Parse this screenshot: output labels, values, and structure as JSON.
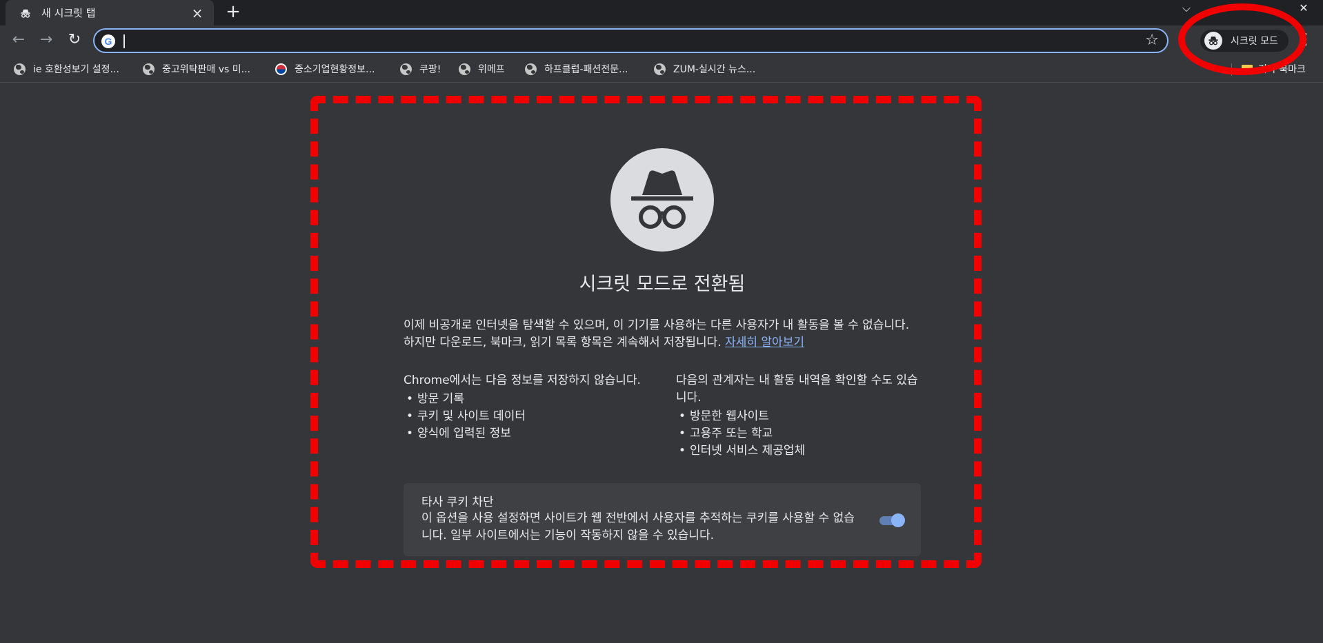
{
  "browser": {
    "tab_title": "새 시크릿 탭",
    "close_glyph": "×",
    "newtab_glyph": "+",
    "window_controls": {
      "chevron": "⌵",
      "minimize": "—",
      "close": "✕"
    },
    "nav": {
      "back": "←",
      "forward": "→",
      "reload": "↻"
    },
    "omnibox": {
      "logo_letter": "G",
      "value": "",
      "placeholder": "",
      "star": "☆"
    },
    "profile_chip": {
      "label": "시크릿 모드",
      "icon": "incognito-icon"
    },
    "menu_glyph": "⋮"
  },
  "bookmarks": {
    "items": [
      {
        "label": "ie 호환성보기 설정...",
        "icon": "globe-icon"
      },
      {
        "label": "중고위탁판매 vs 미...",
        "icon": "globe-icon"
      },
      {
        "label": "중소기업현황정보...",
        "icon": "korea-flag-icon"
      },
      {
        "label": "쿠팡!",
        "icon": "globe-icon"
      },
      {
        "label": "위메프",
        "icon": "globe-icon"
      },
      {
        "label": "하프클럽-패션전문...",
        "icon": "globe-icon"
      },
      {
        "label": "ZUM-실시간 뉴스...",
        "icon": "globe-icon"
      }
    ],
    "other": "기타 북마크"
  },
  "incognito_page": {
    "headline": "시크릿 모드로 전환됨",
    "intro_1": "이제 비공개로 인터넷을 탐색할 수 있으며, 이 기기를 사용하는 다른 사용자가 내 활동을 볼 수 없습니다. 하지만 다운로드, 북마크, 읽기 목록 항목은 계속해서 저장됩니다. ",
    "learn_more": "자세히 알아보기",
    "not_saved": {
      "heading": "Chrome에서는 다음 정보를 저장하지 않습니다.",
      "items": [
        "방문 기록",
        "쿠키 및 사이트 데이터",
        "양식에 입력된 정보"
      ]
    },
    "visible_to": {
      "heading": "다음의 관계자는 내 활동 내역을 확인할 수도 있습니다.",
      "items": [
        "방문한 웹사이트",
        "고용주 또는 학교",
        "인터넷 서비스 제공업체"
      ]
    },
    "cookie_card": {
      "title": "타사 쿠키 차단",
      "description": "이 옵션을 사용 설정하면 사이트가 웹 전반에서 사용자를 추적하는 쿠키를 사용할 수 없습니다. 일부 사이트에서는 기능이 작동하지 않을 수 있습니다.",
      "toggle_on": true
    }
  },
  "colors": {
    "background": "#35363a",
    "titlebar": "#202124",
    "accent": "#8ab4f8",
    "annotation_red": "#f10000"
  }
}
